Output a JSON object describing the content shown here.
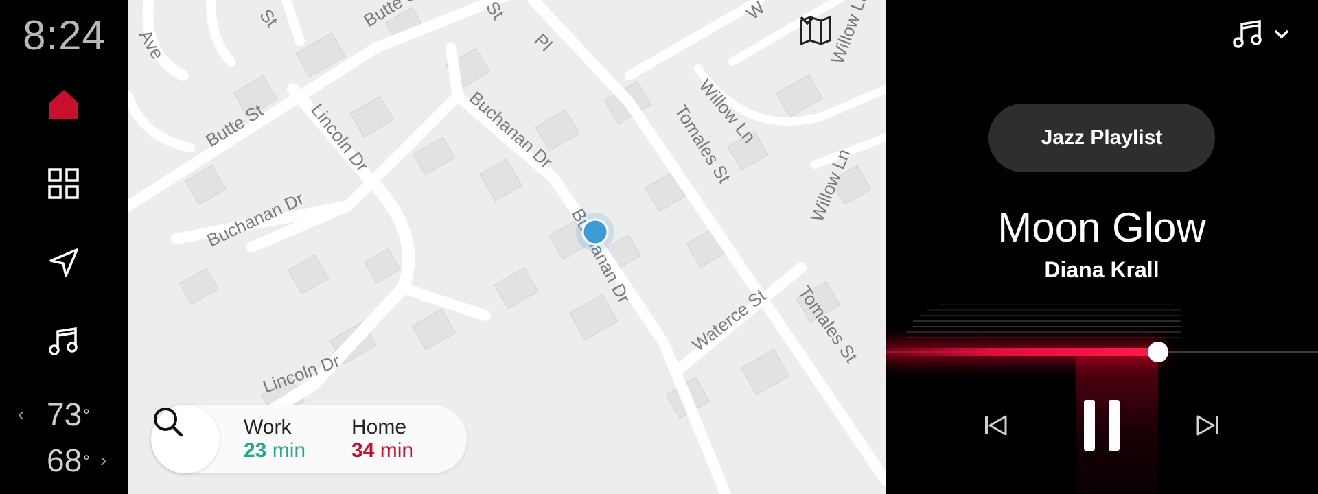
{
  "status": {
    "time": "8:24"
  },
  "rail": {
    "items": [
      {
        "icon": "home-icon",
        "active": true
      },
      {
        "icon": "grid-apps-icon",
        "active": false
      },
      {
        "icon": "navigation-arrow-icon",
        "active": false
      },
      {
        "icon": "music-note-icon",
        "active": false
      }
    ],
    "temp_driver": "73",
    "temp_passenger": "68",
    "degree": "°",
    "accent": "#c8102e"
  },
  "map": {
    "streets": [
      "Butte St",
      "Lincoln Dr",
      "Buchanan Dr",
      "Buchanan Dr",
      "Buchanan Dr",
      "Lincoln Dr",
      "Tomales St",
      "Willow Ln",
      "Willow Ln",
      "Waterce St",
      "Tomales St",
      "Butte St",
      "Ave",
      "St",
      "St",
      "Willow Ln",
      "Pl",
      "W"
    ],
    "tools_icon": "map-layers-icon",
    "location_color": "#3e9bd8",
    "destinations": [
      {
        "name": "Work",
        "minutes": "23",
        "unit": "min",
        "color": "#26a98a"
      },
      {
        "name": "Home",
        "minutes": "34",
        "unit": "min",
        "color": "#c8102e"
      }
    ]
  },
  "media": {
    "source_icon": "music-note-icon",
    "playlist": "Jazz Playlist",
    "title": "Moon Glow",
    "artist": "Diana Krall",
    "progress": 0.63,
    "controls": [
      "previous-track-icon",
      "pause-icon",
      "next-track-icon"
    ]
  }
}
